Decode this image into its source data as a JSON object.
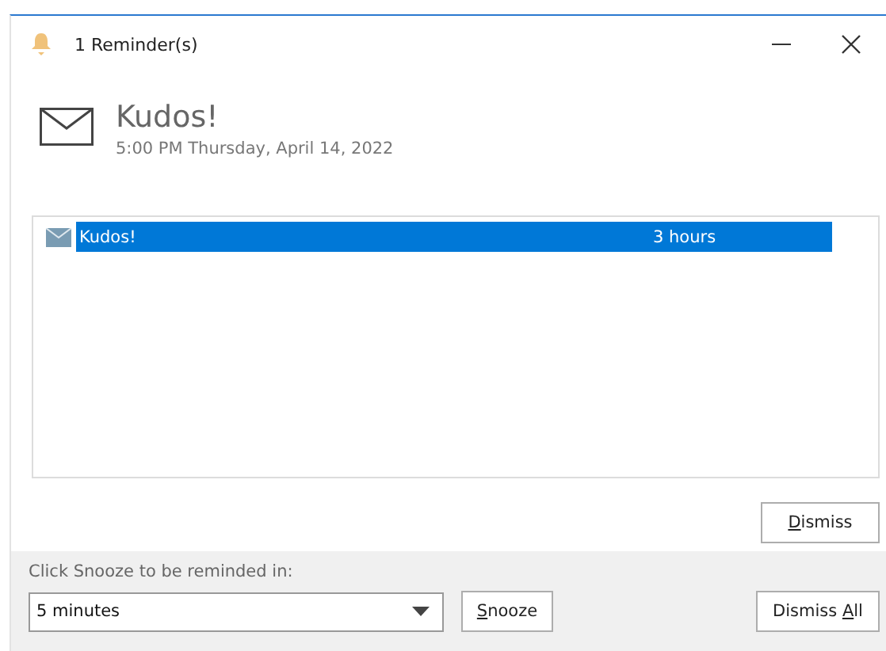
{
  "window": {
    "title": "1 Reminder(s)"
  },
  "header": {
    "subject": "Kudos!",
    "due": "5:00 PM Thursday, April 14, 2022"
  },
  "reminders": [
    {
      "kind": "mail",
      "subject": "Kudos!",
      "due_in": "3 hours",
      "selected": true
    }
  ],
  "dismiss_button": {
    "access_key": "D",
    "after": "ismiss"
  },
  "snooze": {
    "prompt": "Click Snooze to be reminded in:",
    "value": "5 minutes",
    "button": {
      "access_key": "S",
      "after": "nooze"
    }
  },
  "dismiss_all_button": {
    "before": "Dismiss ",
    "access_key": "A",
    "after": "ll"
  }
}
